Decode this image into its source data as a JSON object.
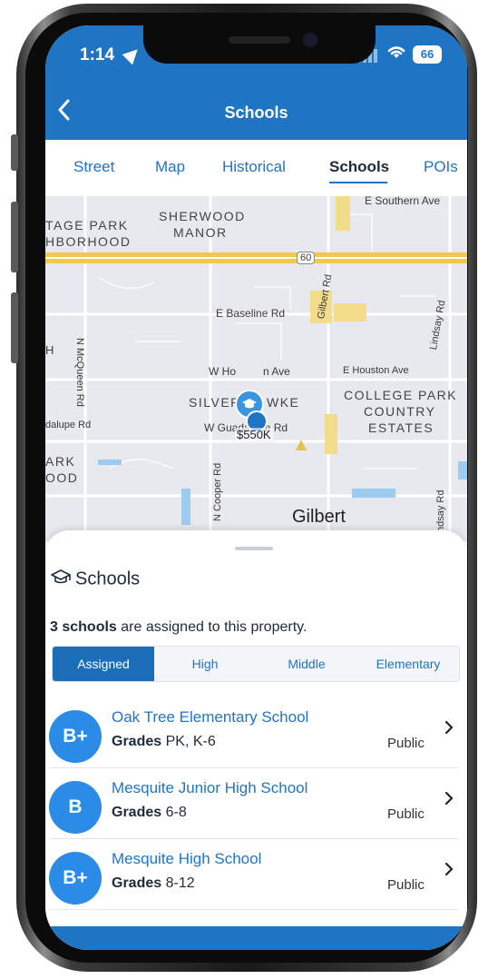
{
  "status_bar": {
    "time": "1:14",
    "battery": "66"
  },
  "nav": {
    "title": "Schools"
  },
  "tabs": [
    {
      "label": "Street"
    },
    {
      "label": "Map"
    },
    {
      "label": "Historical"
    },
    {
      "label": "Schools"
    },
    {
      "label": "POIs"
    }
  ],
  "map": {
    "labels": {
      "e_southern_ave": "E Southern Ave",
      "tage_park": "TAGE PARK",
      "hborhood": "HBORHOOD",
      "sherwood": "SHERWOOD",
      "manor": "MANOR",
      "route": "60",
      "e_baseline": "E Baseline Rd",
      "gilbert_rd": "Gilbert Rd",
      "lindsay_rd_top": "Lindsay Rd",
      "h_partial": "H",
      "n_mcqueen": "N McQueen Rd",
      "w_houston_w": "W Ho",
      "w_houston_ave": "n Ave",
      "e_houston": "E Houston Ave",
      "college_park": "COLLEGE PARK",
      "country": "COUNTRY",
      "estates": "ESTATES",
      "silverhawke_left": "SILVERH",
      "silverhawke_right": "WKE",
      "guadalupe_left": "dalupe Rd",
      "w_guadalupe": "W Guadalupe Rd",
      "n_cooper": "N Cooper Rd",
      "ark": "ARK",
      "ood": "OOD",
      "lindsay_rd_bottom": "ndsay Rd"
    },
    "price": "$550K",
    "city": "Gilbert"
  },
  "sheet": {
    "title": "Schools",
    "summary_bold": "3 schools",
    "summary_rest": " are assigned to this property."
  },
  "filters": [
    {
      "label": "Assigned",
      "active": true
    },
    {
      "label": "High",
      "active": false
    },
    {
      "label": "Middle",
      "active": false
    },
    {
      "label": "Elementary",
      "active": false
    }
  ],
  "schools": [
    {
      "grade": "B+",
      "name": "Oak Tree Elementary School",
      "grades_label": "Grades",
      "grades": "PK, K-6",
      "type": "Public"
    },
    {
      "grade": "B",
      "name": "Mesquite Junior High School",
      "grades_label": "Grades",
      "grades": "6-8",
      "type": "Public"
    },
    {
      "grade": "B+",
      "name": "Mesquite High School",
      "grades_label": "Grades",
      "grades": "8-12",
      "type": "Public"
    }
  ],
  "colors": {
    "accent": "#1f74c4",
    "badge": "#2a8ce6",
    "road_major": "#f0c84b",
    "map_bg": "#e7e9ee"
  },
  "icons": {
    "back": "chevron-left-icon",
    "location": "location-arrow-icon",
    "wifi": "wifi-icon",
    "school_pin": "graduation-cap-icon",
    "row": "chevron-right-icon"
  }
}
